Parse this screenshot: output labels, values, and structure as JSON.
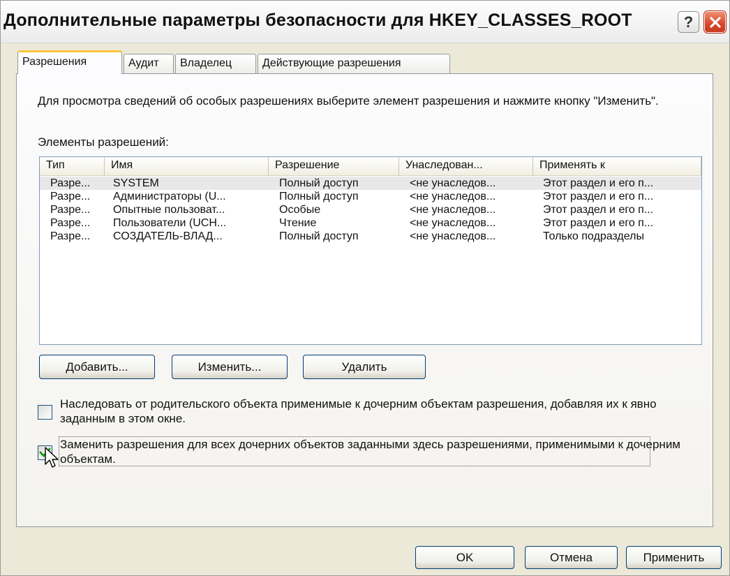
{
  "window": {
    "title": "Дополнительные параметры безопасности для HKEY_CLASSES_ROOT",
    "help_label": "?"
  },
  "tabs": [
    {
      "label": "Разрешения",
      "active": true
    },
    {
      "label": "Аудит",
      "active": false
    },
    {
      "label": "Владелец",
      "active": false
    },
    {
      "label": "Действующие разрешения",
      "active": false
    }
  ],
  "permissions_page": {
    "description": "Для просмотра сведений об особых разрешениях выберите элемент разрешения и нажмите кнопку \"Изменить\".",
    "entries_label": "Элементы разрешений:",
    "columns": [
      "Тип",
      "Имя",
      "Разрешение",
      "Унаследован...",
      "Применять к"
    ],
    "rows": [
      {
        "type": "Разре...",
        "name": "SYSTEM",
        "permission": "Полный доступ",
        "inherited": "<не унаследов...",
        "apply_to": "Этот раздел и его п..."
      },
      {
        "type": "Разре...",
        "name": "Администраторы (U...",
        "permission": "Полный доступ",
        "inherited": "<не унаследов...",
        "apply_to": "Этот раздел и его п..."
      },
      {
        "type": "Разре...",
        "name": "Опытные пользоват...",
        "permission": "Особые",
        "inherited": "<не унаследов...",
        "apply_to": "Этот раздел и его п..."
      },
      {
        "type": "Разре...",
        "name": "Пользователи (UCH...",
        "permission": "Чтение",
        "inherited": "<не унаследов...",
        "apply_to": "Этот раздел и его п..."
      },
      {
        "type": "Разре...",
        "name": "СОЗДАТЕЛЬ-ВЛАД...",
        "permission": "Полный доступ",
        "inherited": "<не унаследов...",
        "apply_to": "Только подразделы"
      }
    ],
    "add_label": "Добавить...",
    "edit_label": "Изменить...",
    "remove_label": "Удалить",
    "inherit_checkbox": {
      "label": "Наследовать от родительского объекта применимые к дочерним объектам разрешения, добавляя их к явно заданным в этом окне.",
      "checked": false
    },
    "replace_checkbox": {
      "label": "Заменить разрешения для всех дочерних объектов заданными здесь разрешениями, применимыми к дочерним объектам.",
      "checked": true
    }
  },
  "footer": {
    "ok_label": "OK",
    "cancel_label": "Отмена",
    "apply_label": "Применить"
  },
  "colors": {
    "dialog_bg": "#ece9d8",
    "active_tab_accent": "#ffc83c",
    "button_border": "#003c74",
    "checkmark": "#21a121"
  }
}
